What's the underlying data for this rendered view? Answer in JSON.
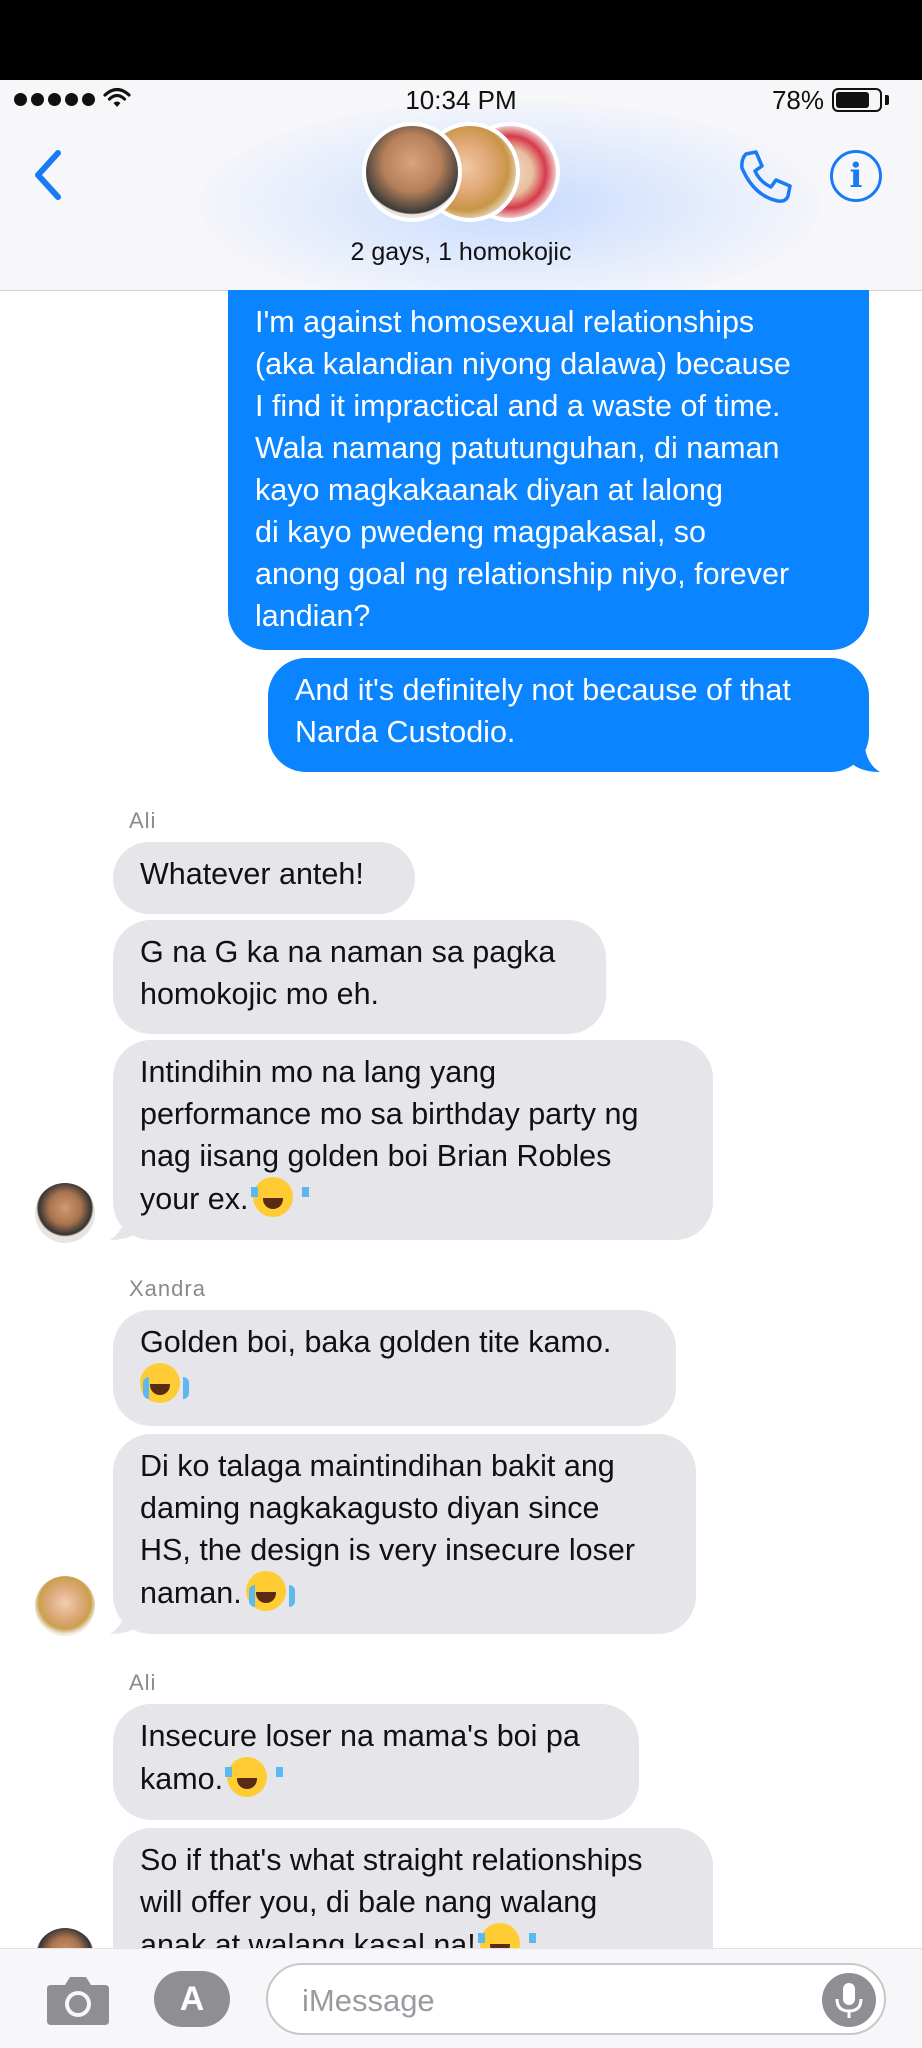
{
  "status_bar": {
    "time": "10:34 PM",
    "battery_percent": "78%",
    "battery_level": 0.78
  },
  "header": {
    "conversation_title": "2 gays, 1 homokojic",
    "back_icon": "chevron-left-icon",
    "call_icon": "phone-icon",
    "info_icon": "info-icon",
    "info_glyph": "i"
  },
  "messages": [
    {
      "type": "outgoing",
      "lines": [
        "I'm against homosexual relationships",
        "(aka kalandian niyong dalawa) because",
        "I find it impractical and a waste of time.",
        "Wala namang patutunguhan, di naman",
        "kayo magkakaanak diyan at lalong",
        "di kayo pwedeng magpakasal, so",
        "anong goal ng relationship niyo, forever",
        "landian?"
      ]
    },
    {
      "type": "outgoing",
      "lines": [
        "And it's definitely not because of that",
        "Narda Custodio."
      ]
    },
    {
      "type": "sender",
      "name": "Ali"
    },
    {
      "type": "incoming",
      "lines": [
        "Whatever anteh!"
      ]
    },
    {
      "type": "incoming",
      "lines": [
        "G na G ka na naman sa pagka",
        "homokojic mo eh."
      ]
    },
    {
      "type": "incoming",
      "lines": [
        "Intindihin mo na lang yang",
        "performance mo sa birthday party ng",
        "nag iisang golden boi Brian Robles",
        "your ex."
      ],
      "emoji": "face-with-tears-of-joy"
    },
    {
      "type": "sender",
      "name": "Xandra"
    },
    {
      "type": "incoming",
      "lines": [
        "Golden boi, baka golden tite kamo.",
        ""
      ],
      "emoji": "loudly-crying-face"
    },
    {
      "type": "incoming",
      "lines": [
        "Di ko talaga maintindihan bakit ang",
        "daming nagkakagusto diyan since",
        "HS, the design is very insecure loser",
        "naman."
      ],
      "emoji": "loudly-crying-face"
    },
    {
      "type": "sender",
      "name": "Ali"
    },
    {
      "type": "incoming",
      "lines": [
        "Insecure loser na mama's boi pa",
        "kamo."
      ],
      "emoji": "face-with-tears-of-joy"
    },
    {
      "type": "incoming",
      "lines": [
        "So if that's what straight relationships",
        "will offer you, di bale nang walang",
        "anak at walang kasal na!"
      ],
      "emoji": "face-with-tears-of-joy"
    }
  ],
  "composer": {
    "placeholder": "iMessage",
    "camera_icon": "camera-icon",
    "apps_icon": "app-store-icon",
    "mic_icon": "microphone-icon"
  },
  "colors": {
    "outgoing_bubble": "#0a84ff",
    "incoming_bubble": "#e5e5ea",
    "accent": "#1a7cf5"
  }
}
